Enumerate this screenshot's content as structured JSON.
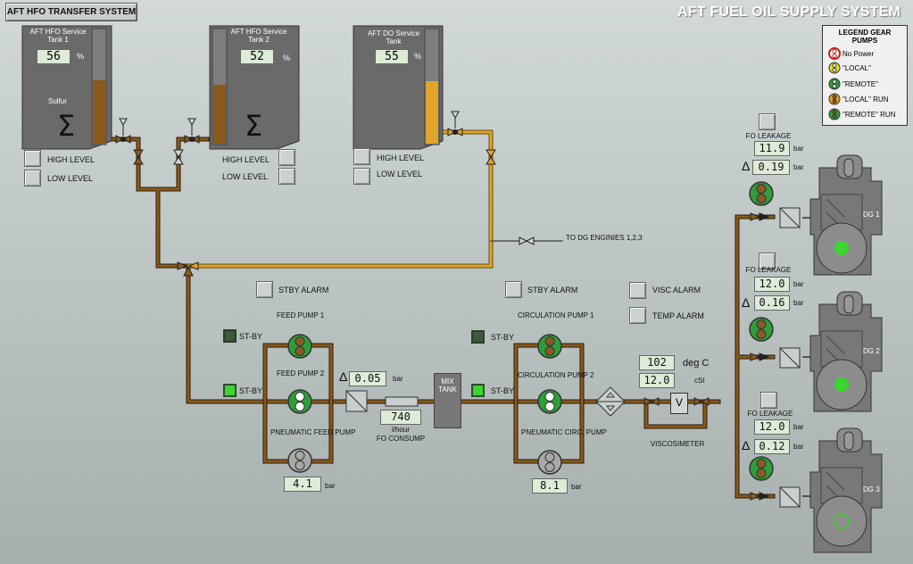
{
  "header": {
    "nav_button": "AFT HFO TRANSFER SYSTEM",
    "title": "AFT FUEL OIL SUPPLY SYSTEM"
  },
  "legend": {
    "title": "LEGEND GEAR PUMPS",
    "items": [
      "No Power",
      "\"LOCAL\"",
      "\"REMOTE\"",
      "\"LOCAL\" RUN",
      "\"REMOTE\" RUN"
    ]
  },
  "tanks": [
    {
      "title": "AFT HFO Service Tank 1",
      "level": "56",
      "unit": "%",
      "label": "Sulfur",
      "fill": 0.56
    },
    {
      "title": "AFT HFO Service Tank 2",
      "level": "52",
      "unit": "%",
      "fill": 0.52
    },
    {
      "title": "AFT DO Service Tank",
      "level": "55",
      "unit": "%",
      "fill": 0.55
    }
  ],
  "level_labels": {
    "high": "HIGH LEVEL",
    "low": "LOW LEVEL"
  },
  "to_dg": "TO DG ENGINIES 1,2,3",
  "alarms": {
    "stby": "STBY ALARM",
    "visc": "VISC ALARM",
    "temp": "TEMP ALARM"
  },
  "feed": {
    "pump1": "FEED PUMP 1",
    "pump2": "FEED PUMP 2",
    "pneumatic": "PNEUMATIC FEED PUMP",
    "stby": "ST-BY",
    "pressure": "4.1",
    "unit": "bar"
  },
  "circ": {
    "pump1": "CIRCULATION PUMP 1",
    "pump2": "CIRCULATION PUMP 2",
    "pneumatic": "PNEUMATIC CIRC. PUMP",
    "pressure": "8.1",
    "unit": "bar"
  },
  "filter_dp": {
    "value": "0.05",
    "unit": "bar"
  },
  "consumption": {
    "value": "740",
    "unit": "l/hour",
    "label": "FO CONSUMP"
  },
  "mix_tank": "MIX TANK",
  "visco": {
    "temp": "102",
    "temp_unit": "deg C",
    "visc": "12.0",
    "visc_unit": "cSt",
    "label": "VISCOSIMETER",
    "symbol": "V"
  },
  "engines": [
    {
      "name": "DG 1",
      "leak_label": "FO LEAKAGE",
      "pressure": "11.9",
      "dp": "0.19",
      "unit": "bar",
      "running": true
    },
    {
      "name": "DG 2",
      "leak_label": "FO LEAKAGE",
      "pressure": "12.0",
      "dp": "0.16",
      "unit": "bar",
      "running": true
    },
    {
      "name": "DG 3",
      "leak_label": "FO LEAKAGE",
      "pressure": "12.0",
      "dp": "0.12",
      "unit": "bar",
      "running": false
    }
  ],
  "delta_symbol": "Δ",
  "colors": {
    "pipe_hfo": "#8a5a1c",
    "pipe_do": "#e0a52a",
    "pump_green": "#2e9e3a",
    "run_brown": "#8a5a2a",
    "lamp_on": "#3bd52f"
  }
}
